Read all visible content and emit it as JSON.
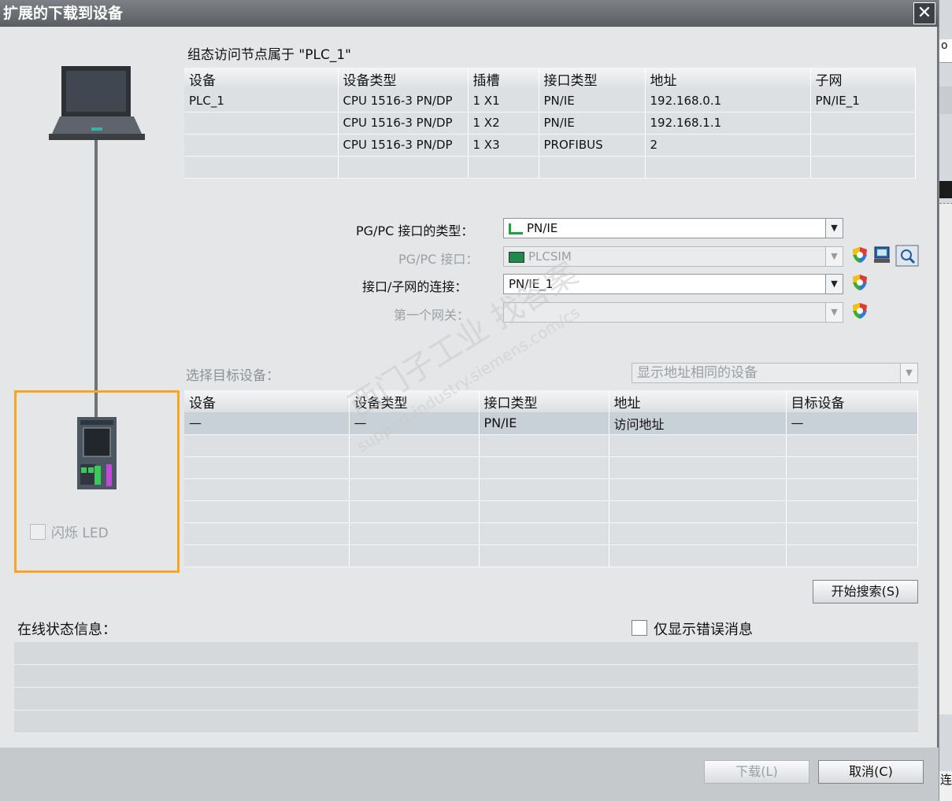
{
  "window": {
    "title": "扩展的下载到设备",
    "close_glyph": "✕"
  },
  "access_node_label": "组态访问节点属于 \"PLC_1\"",
  "config_table": {
    "headers": [
      "设备",
      "设备类型",
      "插槽",
      "接口类型",
      "地址",
      "子网"
    ],
    "rows": [
      [
        "PLC_1",
        "CPU 1516-3 PN/DP",
        "1 X1",
        "PN/IE",
        "192.168.0.1",
        "PN/IE_1"
      ],
      [
        "",
        "CPU 1516-3 PN/DP",
        "1 X2",
        "PN/IE",
        "192.168.1.1",
        ""
      ],
      [
        "",
        "CPU 1516-3 PN/DP",
        "1 X3",
        "PROFIBUS",
        "2",
        ""
      ],
      [
        "",
        "",
        "",
        "",
        "",
        ""
      ]
    ]
  },
  "pgpc_type": {
    "label": "PG/PC 接口的类型：",
    "value": "PN/IE"
  },
  "pgpc_iface": {
    "label": "PG/PC 接口：",
    "value": "PLCSIM"
  },
  "subnet_conn": {
    "label": "接口/子网的连接：",
    "value": "PN/IE_1"
  },
  "gateway": {
    "label": "第一个网关：",
    "value": ""
  },
  "select_target": {
    "label": "选择目标设备：",
    "filter": "显示地址相同的设备"
  },
  "target_table": {
    "headers": [
      "设备",
      "设备类型",
      "接口类型",
      "地址",
      "目标设备"
    ],
    "rows": [
      [
        "—",
        "—",
        "PN/IE",
        "访问地址",
        "—"
      ],
      [
        "",
        "",
        "",
        "",
        ""
      ],
      [
        "",
        "",
        "",
        "",
        ""
      ],
      [
        "",
        "",
        "",
        "",
        ""
      ],
      [
        "",
        "",
        "",
        "",
        ""
      ],
      [
        "",
        "",
        "",
        "",
        ""
      ],
      [
        "",
        "",
        "",
        "",
        ""
      ]
    ]
  },
  "flash_led": "闪烁 LED",
  "start_search": "开始搜索(S)",
  "online_status": "在线状态信息：",
  "errors_only": "仅显示错误消息",
  "download_btn": "下载(L)",
  "cancel_btn": "取消(C)",
  "watermark": {
    "line1": "西门子工业  找答案",
    "line2": "support.industry.siemens.com/cs"
  },
  "background_app": {
    "text_top": "o",
    "text_bottom": "连"
  },
  "colors": {
    "highlight_border": "#f5a623",
    "title_bar": "#5f6368"
  }
}
